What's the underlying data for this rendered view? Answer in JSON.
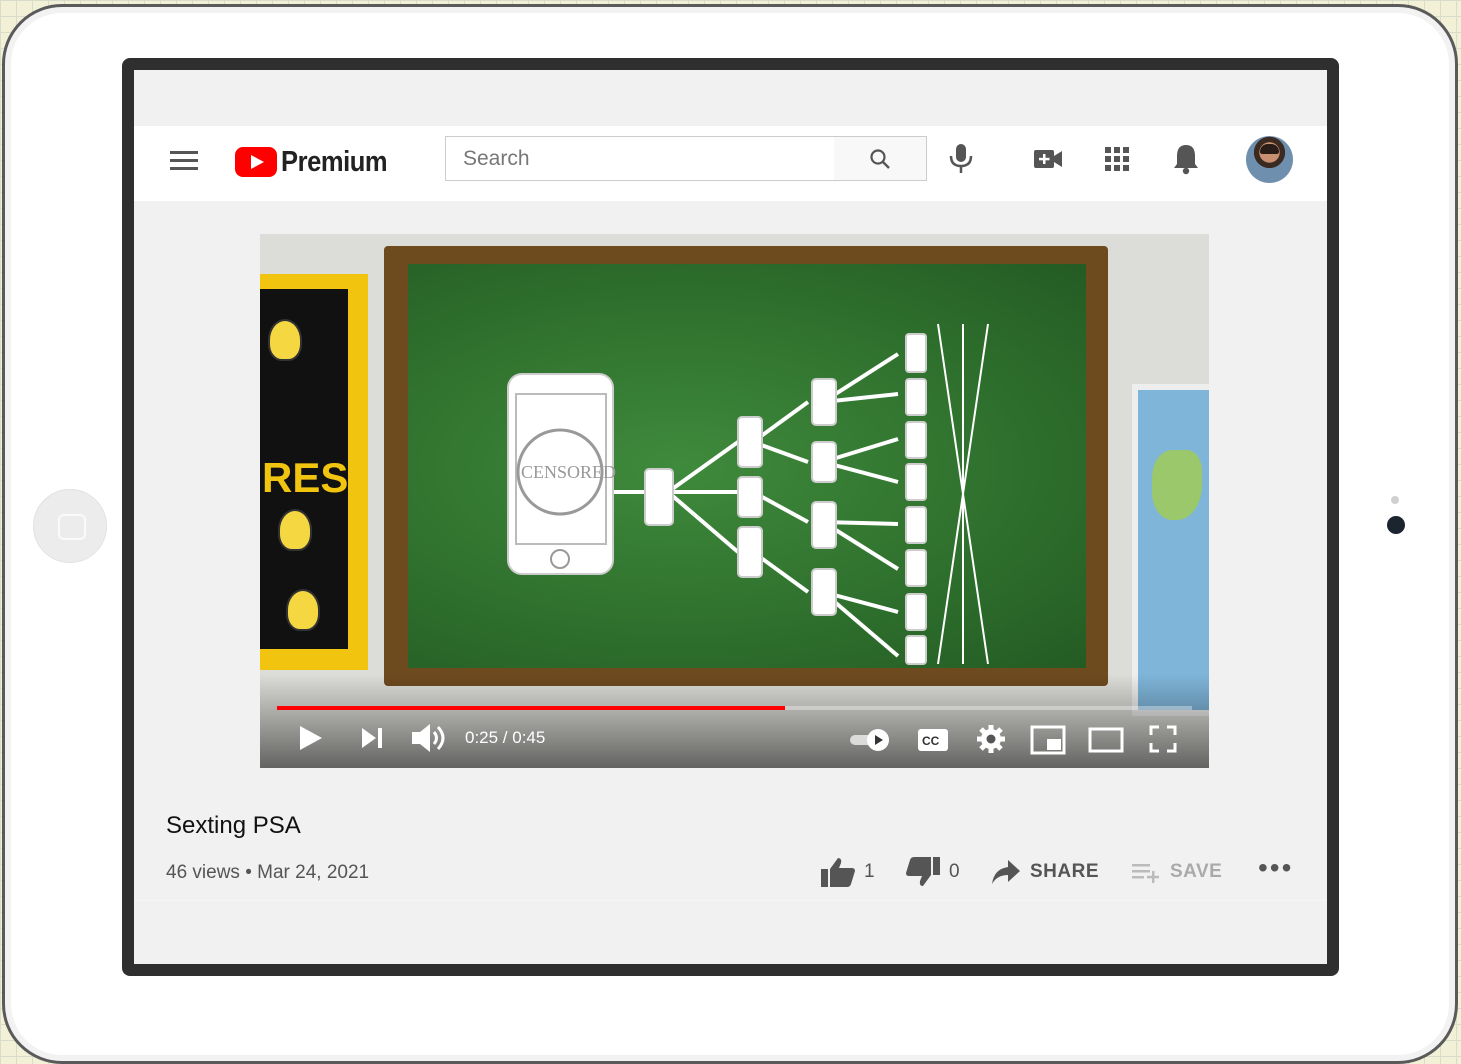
{
  "header": {
    "logo_text": "Premium",
    "search_placeholder": "Search"
  },
  "player": {
    "time": "0:25 / 0:45",
    "progress_fraction": 0.555,
    "board_text": "CENSORED",
    "bulletin_text": "RES"
  },
  "video": {
    "title": "Sexting PSA",
    "views": "46 views",
    "separator": "•",
    "date": "Mar 24, 2021"
  },
  "actions": {
    "likes": "1",
    "dislikes": "0",
    "share": "SHARE",
    "save": "SAVE",
    "more": "•••"
  },
  "colors": {
    "accent": "#ff0000",
    "icon": "#555555"
  }
}
